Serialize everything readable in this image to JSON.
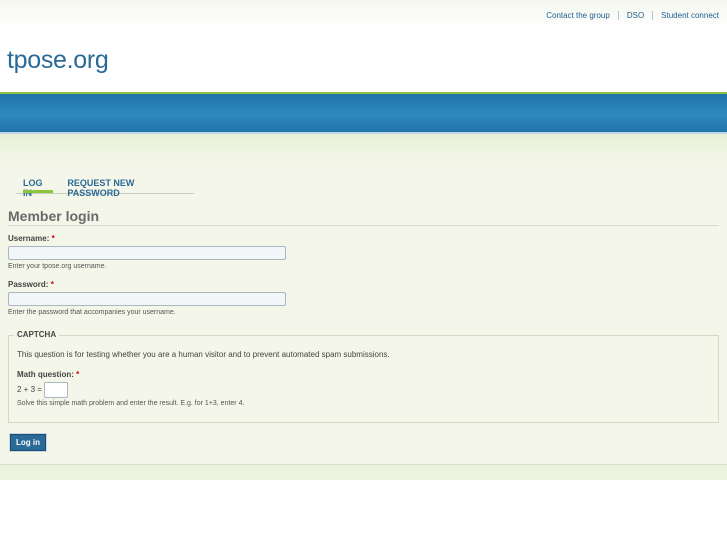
{
  "header": {
    "links": [
      "Contact the group",
      "DSO",
      "Student connect"
    ],
    "site_name": "tpose.org"
  },
  "tabs": [
    {
      "label": "LOG IN",
      "active": true
    },
    {
      "label": "REQUEST NEW PASSWORD",
      "active": false
    }
  ],
  "page": {
    "title": "Member login"
  },
  "form": {
    "username": {
      "label": "Username:",
      "required_mark": "*",
      "value": "",
      "description": "Enter your tpose.org username."
    },
    "password": {
      "label": "Password:",
      "required_mark": "*",
      "value": "",
      "description": "Enter the password that accompanies your username."
    },
    "captcha": {
      "legend": "CAPTCHA",
      "text": "This question is for testing whether you are a human visitor and to prevent automated spam submissions.",
      "math_label": "Math question:",
      "required_mark": "*",
      "equation": "2 + 3 =",
      "value": "",
      "description": "Solve this simple math problem and enter the result. E.g. for 1+3, enter 4."
    },
    "submit_label": "Log in"
  },
  "colors": {
    "brand_blue": "#2a6a97",
    "accent_green": "#8cc63f",
    "background": "#f4f6e9"
  }
}
